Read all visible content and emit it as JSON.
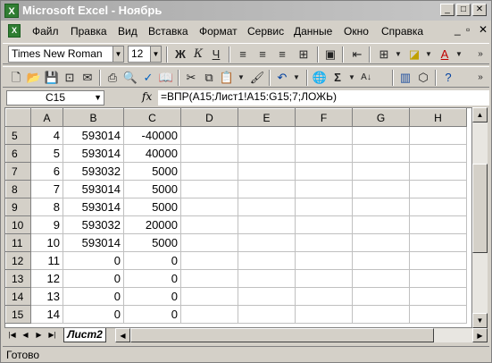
{
  "window": {
    "title": "Microsoft Excel - Ноябрь"
  },
  "menu": [
    "Файл",
    "Правка",
    "Вид",
    "Вставка",
    "Формат",
    "Сервис",
    "Данные",
    "Окно",
    "Справка"
  ],
  "toolbar": {
    "font_name": "Times New Roman",
    "font_size": "12",
    "bold_label": "Ж",
    "italic_label": "К",
    "underline_label": "Ч",
    "sum_label": "Σ",
    "zoom_label": "?"
  },
  "formula_bar": {
    "name_box": "C15",
    "fx_label": "fx",
    "formula": "=ВПР(A15;Лист1!A15:G15;7;ЛОЖЬ)"
  },
  "grid": {
    "columns": [
      "A",
      "B",
      "C",
      "D",
      "E",
      "F",
      "G",
      "H"
    ],
    "rows": [
      {
        "num": "5",
        "a": "4",
        "b": "593014",
        "c": "-40000"
      },
      {
        "num": "6",
        "a": "5",
        "b": "593014",
        "c": "40000"
      },
      {
        "num": "7",
        "a": "6",
        "b": "593032",
        "c": "5000"
      },
      {
        "num": "8",
        "a": "7",
        "b": "593014",
        "c": "5000"
      },
      {
        "num": "9",
        "a": "8",
        "b": "593014",
        "c": "5000"
      },
      {
        "num": "10",
        "a": "9",
        "b": "593032",
        "c": "20000"
      },
      {
        "num": "11",
        "a": "10",
        "b": "593014",
        "c": "5000"
      },
      {
        "num": "12",
        "a": "11",
        "b": "0",
        "c": "0"
      },
      {
        "num": "13",
        "a": "12",
        "b": "0",
        "c": "0"
      },
      {
        "num": "14",
        "a": "13",
        "b": "0",
        "c": "0"
      },
      {
        "num": "15",
        "a": "14",
        "b": "0",
        "c": "0"
      }
    ]
  },
  "sheet_tab": "Лист2",
  "status": "Готово",
  "colors": {
    "title_bar": "#b0b0b0",
    "chrome": "#d4d0c8"
  }
}
